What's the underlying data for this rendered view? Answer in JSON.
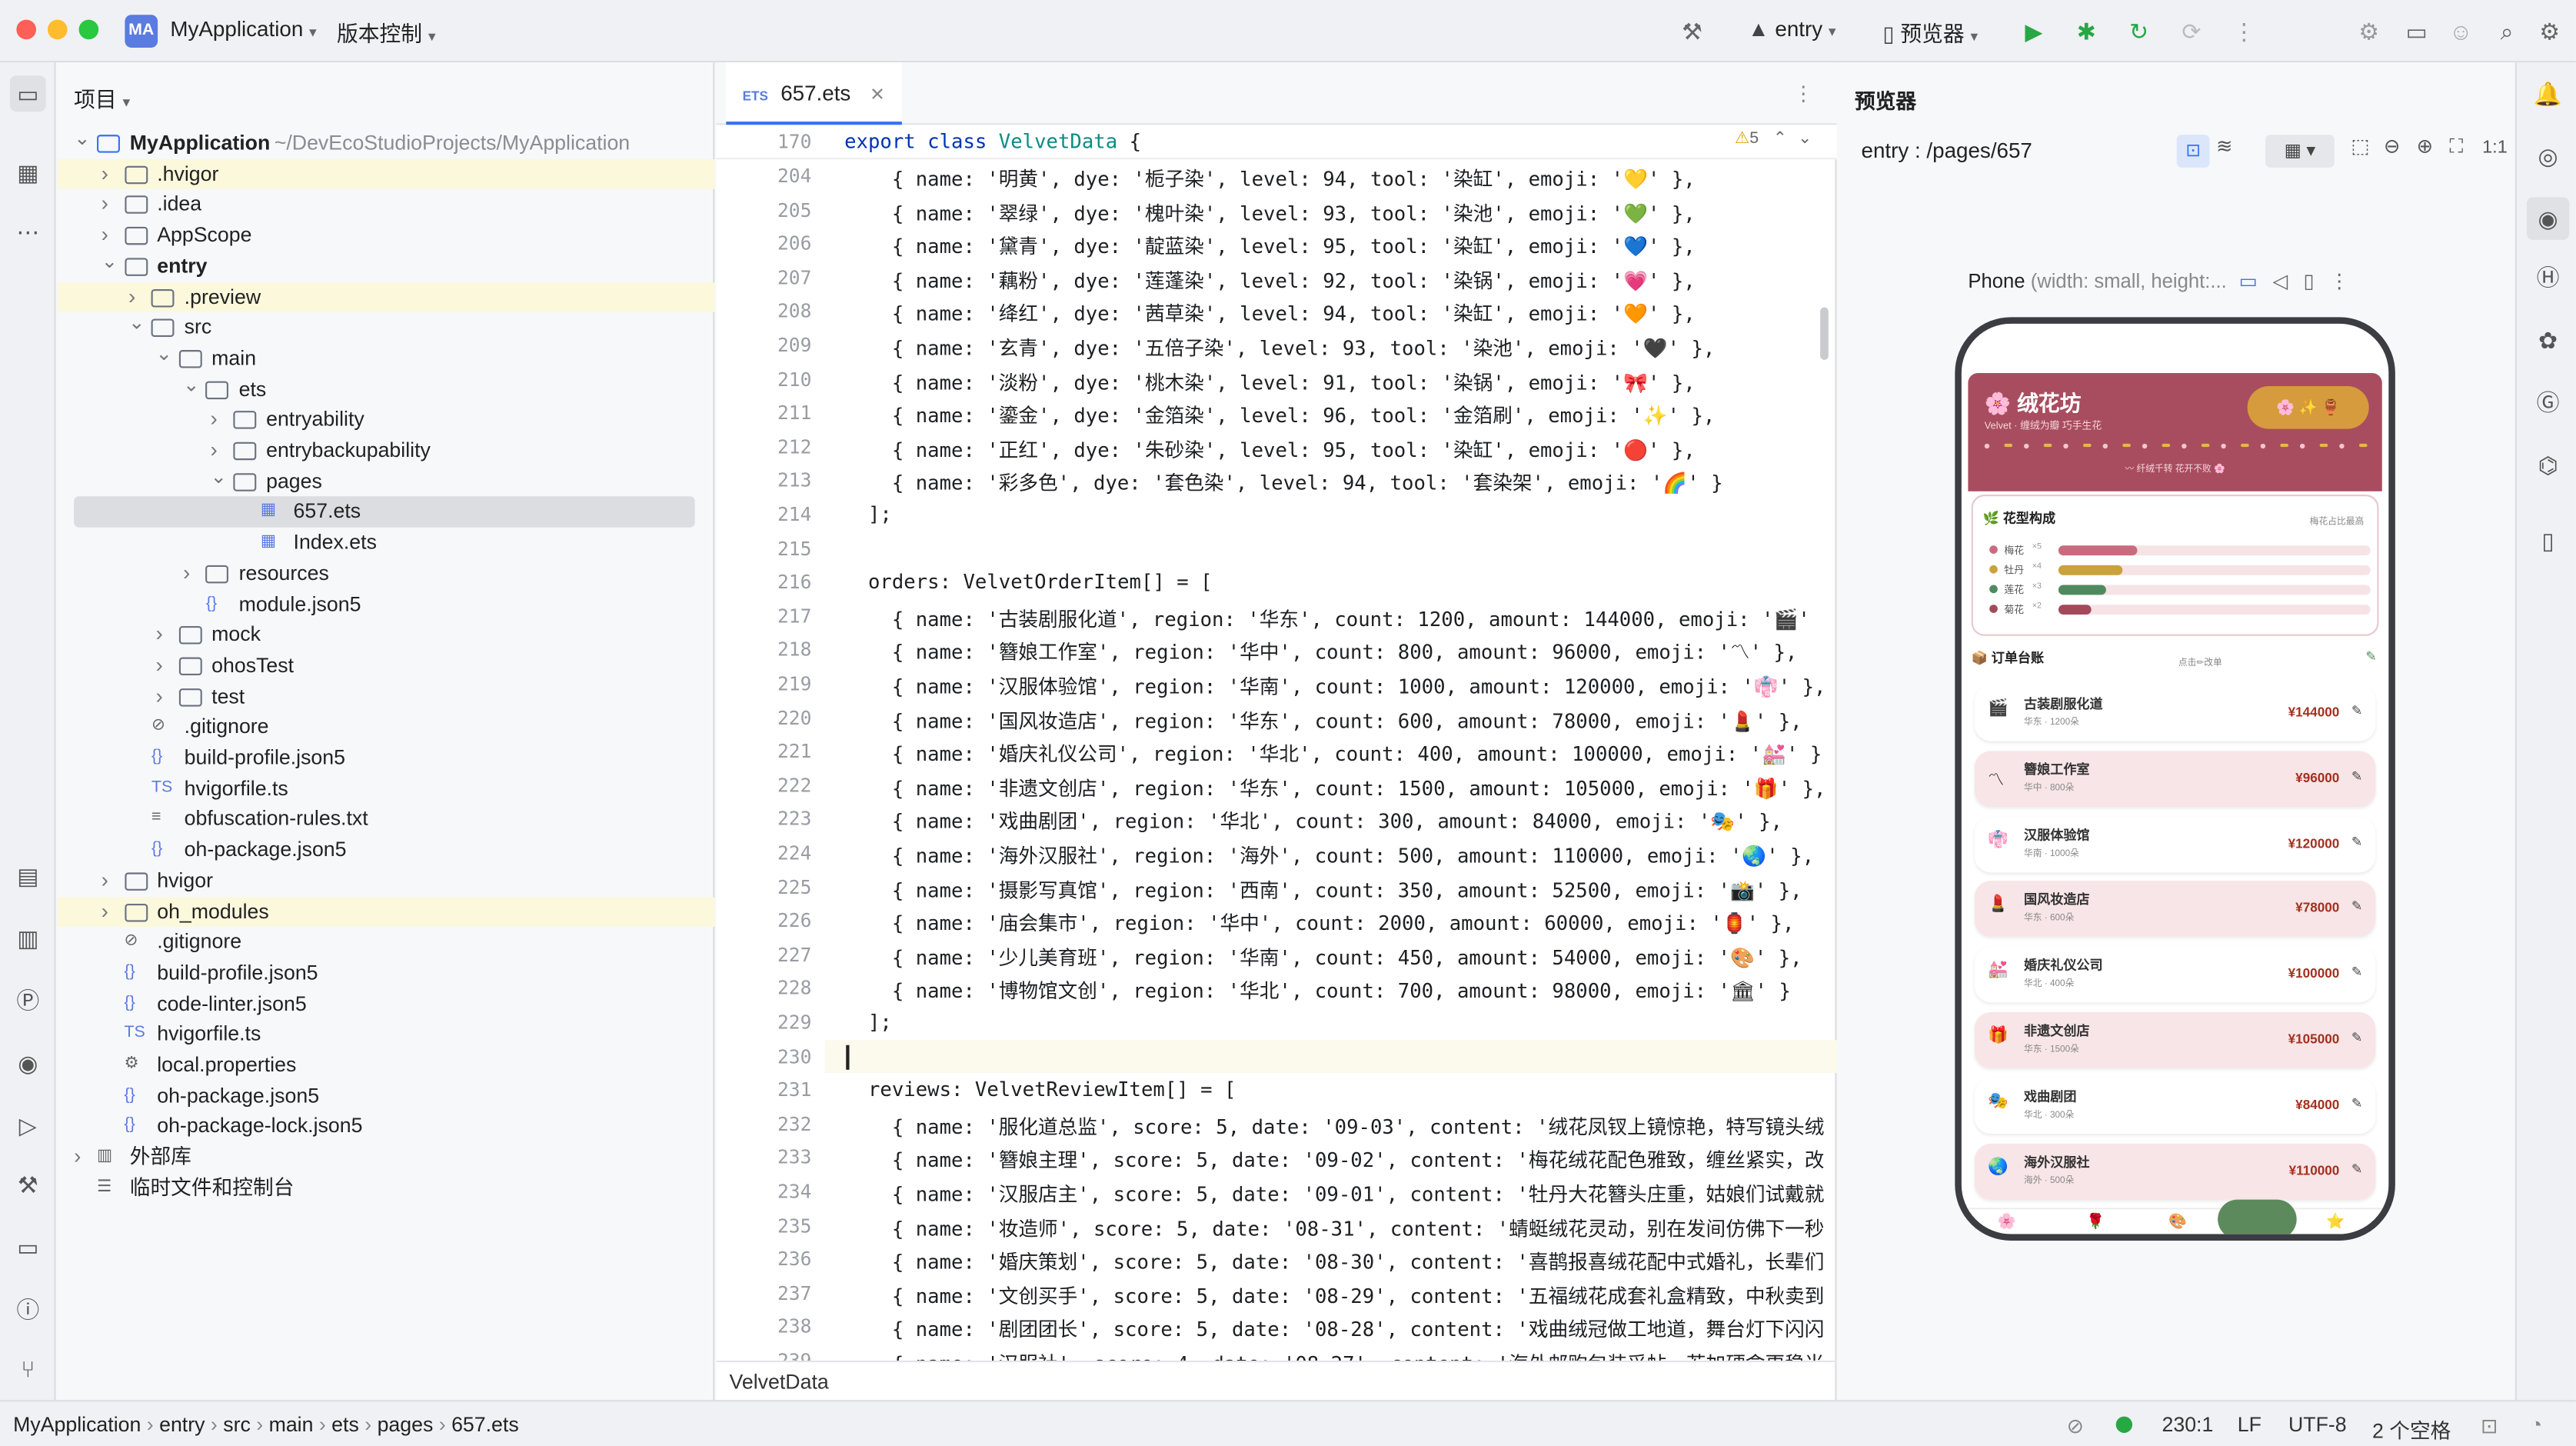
{
  "titlebar": {
    "app_badge": "MA",
    "project": "MyApplication",
    "vcs": "版本控制",
    "run_config": "entry",
    "device": "预览器"
  },
  "project_panel": {
    "title": "项目",
    "rows": [
      {
        "text": "MyApplication",
        "extra": "~/DevEcoStudioProjects/MyApplication"
      },
      {
        "text": ".hvigor"
      },
      {
        "text": ".idea"
      },
      {
        "text": "AppScope"
      },
      {
        "text": "entry"
      },
      {
        "text": ".preview"
      },
      {
        "text": "src"
      },
      {
        "text": "main"
      },
      {
        "text": "ets"
      },
      {
        "text": "entryability"
      },
      {
        "text": "entrybackupability"
      },
      {
        "text": "pages"
      },
      {
        "text": "657.ets"
      },
      {
        "text": "Index.ets"
      },
      {
        "text": "resources"
      },
      {
        "text": "module.json5"
      },
      {
        "text": "mock"
      },
      {
        "text": "ohosTest"
      },
      {
        "text": "test"
      },
      {
        "text": ".gitignore"
      },
      {
        "text": "build-profile.json5"
      },
      {
        "text": "hvigorfile.ts"
      },
      {
        "text": "obfuscation-rules.txt"
      },
      {
        "text": "oh-package.json5"
      },
      {
        "text": "hvigor"
      },
      {
        "text": "oh_modules"
      },
      {
        "text": ".gitignore"
      },
      {
        "text": "build-profile.json5"
      },
      {
        "text": "code-linter.json5"
      },
      {
        "text": "hvigorfile.ts"
      },
      {
        "text": "local.properties"
      },
      {
        "text": "oh-package.json5"
      },
      {
        "text": "oh-package-lock.json5"
      },
      {
        "text": "外部库"
      },
      {
        "text": "临时文件和控制台"
      }
    ]
  },
  "editor": {
    "tab": "657.ets",
    "sticky_line": "170",
    "sticky_code": "export class VelvetData {",
    "warnings": "5",
    "breadcrumb": "VelvetData",
    "lines": [
      {
        "n": "204",
        "code": "    { name: '明黄', dye: '栀子染', level: 94, tool: '染缸', emoji: '💛' },"
      },
      {
        "n": "205",
        "code": "    { name: '翠绿', dye: '槐叶染', level: 93, tool: '染池', emoji: '💚' },"
      },
      {
        "n": "206",
        "code": "    { name: '黛青', dye: '靛蓝染', level: 95, tool: '染缸', emoji: '💙' },"
      },
      {
        "n": "207",
        "code": "    { name: '藕粉', dye: '莲蓬染', level: 92, tool: '染锅', emoji: '💗' },"
      },
      {
        "n": "208",
        "code": "    { name: '绛红', dye: '茜草染', level: 94, tool: '染缸', emoji: '🧡' },"
      },
      {
        "n": "209",
        "code": "    { name: '玄青', dye: '五倍子染', level: 93, tool: '染池', emoji: '🖤' },"
      },
      {
        "n": "210",
        "code": "    { name: '淡粉', dye: '桃木染', level: 91, tool: '染锅', emoji: '🎀' },"
      },
      {
        "n": "211",
        "code": "    { name: '鎏金', dye: '金箔染', level: 96, tool: '金箔刷', emoji: '✨' },"
      },
      {
        "n": "212",
        "code": "    { name: '正红', dye: '朱砂染', level: 95, tool: '染缸', emoji: '🔴' },"
      },
      {
        "n": "213",
        "code": "    { name: '彩多色', dye: '套色染', level: 94, tool: '套染架', emoji: '🌈' }"
      },
      {
        "n": "214",
        "code": "  ];"
      },
      {
        "n": "215",
        "code": ""
      },
      {
        "n": "216",
        "code": "  orders: VelvetOrderItem[] = ["
      },
      {
        "n": "217",
        "code": "    { name: '古装剧服化道', region: '华东', count: 1200, amount: 144000, emoji: '🎬'"
      },
      {
        "n": "218",
        "code": "    { name: '簪娘工作室', region: '华中', count: 800, amount: 96000, emoji: '〽' },"
      },
      {
        "n": "219",
        "code": "    { name: '汉服体验馆', region: '华南', count: 1000, amount: 120000, emoji: '👘' },"
      },
      {
        "n": "220",
        "code": "    { name: '国风妆造店', region: '华东', count: 600, amount: 78000, emoji: '💄' },"
      },
      {
        "n": "221",
        "code": "    { name: '婚庆礼仪公司', region: '华北', count: 400, amount: 100000, emoji: '💒' }"
      },
      {
        "n": "222",
        "code": "    { name: '非遗文创店', region: '华东', count: 1500, amount: 105000, emoji: '🎁' },"
      },
      {
        "n": "223",
        "code": "    { name: '戏曲剧团', region: '华北', count: 300, amount: 84000, emoji: '🎭' },"
      },
      {
        "n": "224",
        "code": "    { name: '海外汉服社', region: '海外', count: 500, amount: 110000, emoji: '🌏' },"
      },
      {
        "n": "225",
        "code": "    { name: '摄影写真馆', region: '西南', count: 350, amount: 52500, emoji: '📸' },"
      },
      {
        "n": "226",
        "code": "    { name: '庙会集市', region: '华中', count: 2000, amount: 60000, emoji: '🏮' },"
      },
      {
        "n": "227",
        "code": "    { name: '少儿美育班', region: '华南', count: 450, amount: 54000, emoji: '🎨' },"
      },
      {
        "n": "228",
        "code": "    { name: '博物馆文创', region: '华北', count: 700, amount: 98000, emoji: '🏛' }"
      },
      {
        "n": "229",
        "code": "  ];"
      },
      {
        "n": "230",
        "code": ""
      },
      {
        "n": "231",
        "code": "  reviews: VelvetReviewItem[] = ["
      },
      {
        "n": "232",
        "code": "    { name: '服化道总监', score: 5, date: '09-03', content: '绒花凤钗上镜惊艳，特写镜头绒"
      },
      {
        "n": "233",
        "code": "    { name: '簪娘主理', score: 5, date: '09-02', content: '梅花绒花配色雅致，缠丝紧实，改"
      },
      {
        "n": "234",
        "code": "    { name: '汉服店主', score: 5, date: '09-01', content: '牡丹大花簪头庄重，姑娘们试戴就"
      },
      {
        "n": "235",
        "code": "    { name: '妆造师', score: 5, date: '08-31', content: '蜻蜓绒花灵动，别在发间仿佛下一秒"
      },
      {
        "n": "236",
        "code": "    { name: '婚庆策划', score: 5, date: '08-30', content: '喜鹊报喜绒花配中式婚礼，长辈们"
      },
      {
        "n": "237",
        "code": "    { name: '文创买手', score: 5, date: '08-29', content: '五福绒花成套礼盒精致，中秋卖到"
      },
      {
        "n": "238",
        "code": "    { name: '剧团团长', score: 5, date: '08-28', content: '戏曲绒冠做工地道，舞台灯下闪闪"
      },
      {
        "n": "239",
        "code": "    { name: '汉服社', score: 4, date: '08-27', content: '海外邮购包装妥帖，若加硬盒更稳当"
      }
    ]
  },
  "preview": {
    "title": "预览器",
    "route": "entry : /pages/657",
    "device_label": "Phone",
    "device_desc": "(width: small, height:..."
  },
  "app": {
    "title": "绒花坊",
    "subtitle": "Velvet · 缠绒为瓣 巧手生花",
    "badge_text": "✨ 🏺",
    "tagline": "〰 纤绒千转   花开不败 🌸",
    "comp_title": "花型构成",
    "comp_hint": "梅花占比最高",
    "comp": [
      {
        "name": "梅花",
        "count": "×5",
        "pct": 0.32,
        "color": "#c96b7e"
      },
      {
        "name": "牡丹",
        "count": "×4",
        "pct": 0.26,
        "color": "#c9a23c"
      },
      {
        "name": "莲花",
        "count": "×3",
        "pct": 0.19,
        "color": "#4f8a5e"
      },
      {
        "name": "菊花",
        "count": "×2",
        "pct": 0.13,
        "color": "#a34a5a"
      }
    ],
    "orders_title": "订单台账",
    "orders_hint": "点击✏改单",
    "orders": [
      {
        "name": "古装剧服化道",
        "sub": "华东 · 1200朵",
        "amount": "¥144000",
        "emoji": "🎬",
        "pink": false
      },
      {
        "name": "簪娘工作室",
        "sub": "华中 · 800朵",
        "amount": "¥96000",
        "emoji": "〽",
        "pink": true
      },
      {
        "name": "汉服体验馆",
        "sub": "华南 · 1000朵",
        "amount": "¥120000",
        "emoji": "👘",
        "pink": false
      },
      {
        "name": "国风妆造店",
        "sub": "华东 · 600朵",
        "amount": "¥78000",
        "emoji": "💄",
        "pink": true
      },
      {
        "name": "婚庆礼仪公司",
        "sub": "华北 · 400朵",
        "amount": "¥100000",
        "emoji": "💒",
        "pink": false
      },
      {
        "name": "非遗文创店",
        "sub": "华东 · 1500朵",
        "amount": "¥105000",
        "emoji": "🎁",
        "pink": true
      },
      {
        "name": "戏曲剧团",
        "sub": "华北 · 300朵",
        "amount": "¥84000",
        "emoji": "🎭",
        "pink": false
      },
      {
        "name": "海外汉服社",
        "sub": "海外 · 500朵",
        "amount": "¥110000",
        "emoji": "🌏",
        "pink": true
      }
    ]
  },
  "status": {
    "crumbs": [
      "MyApplication",
      "entry",
      "src",
      "main",
      "ets",
      "pages",
      "657.ets"
    ],
    "position": "230:1",
    "line_ending": "LF",
    "encoding": "UTF-8",
    "indent": "2 个空格"
  },
  "colors": {
    "accent": "#3574f0",
    "app_header": "#a84d5f",
    "app_pink": "#f8e5e7"
  }
}
